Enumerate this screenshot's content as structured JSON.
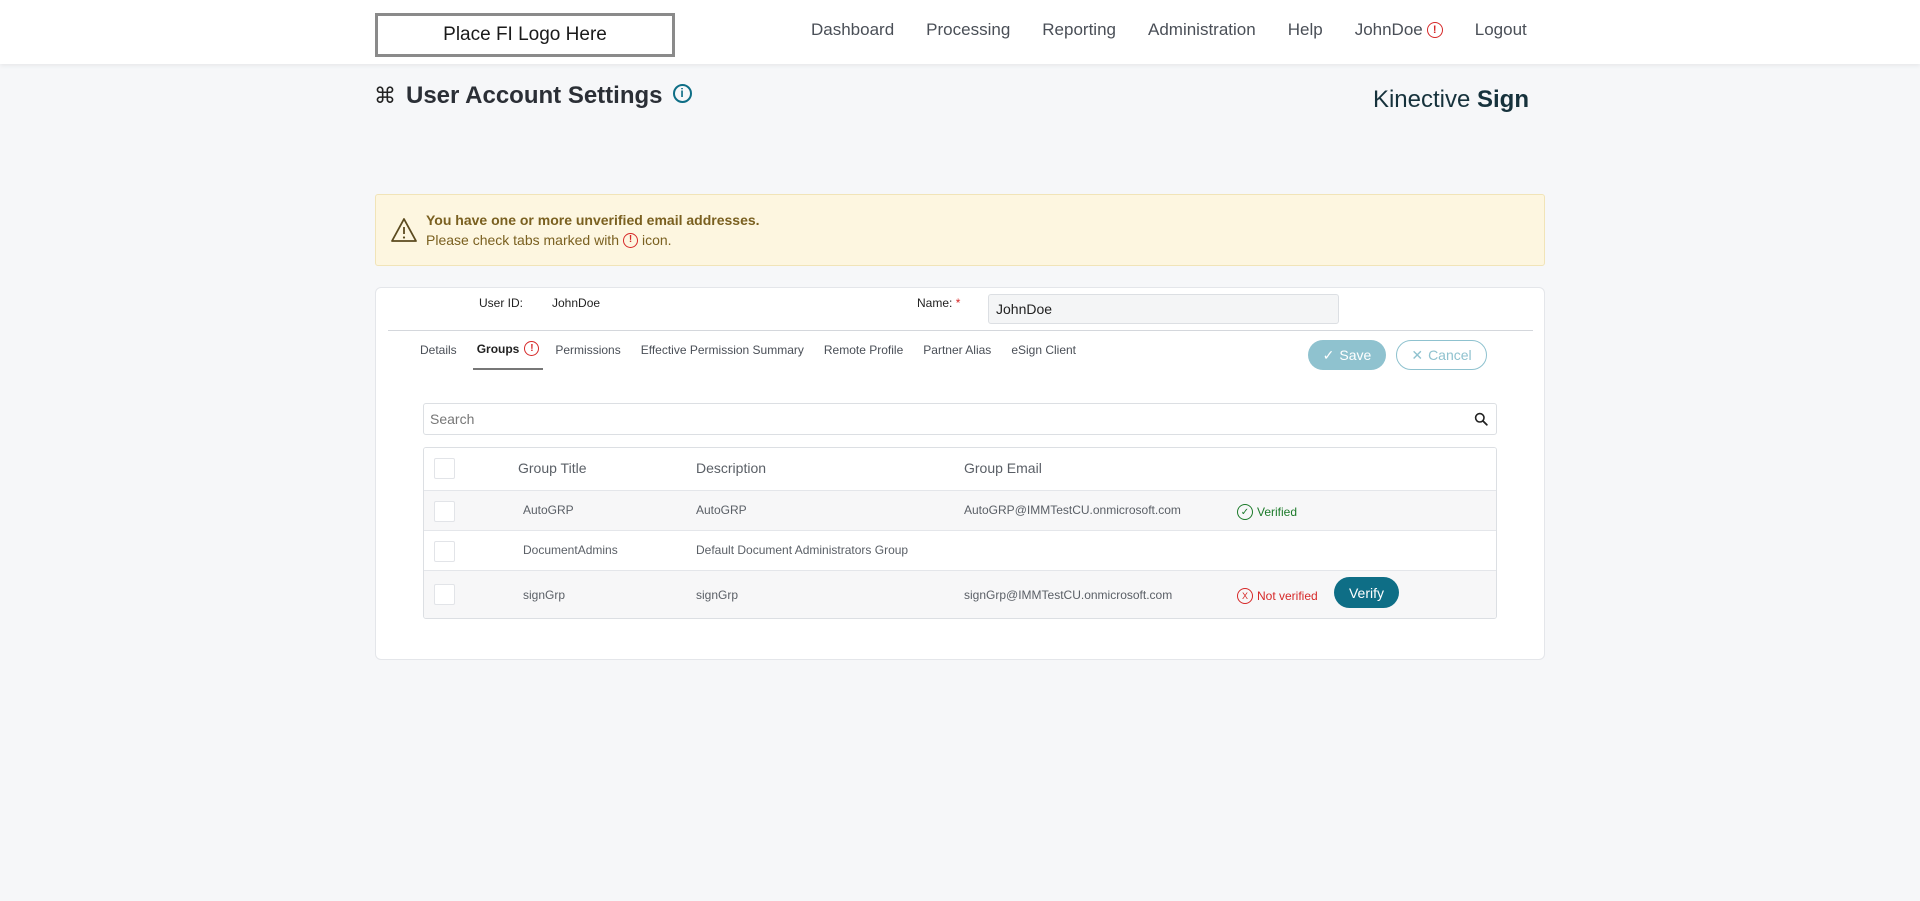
{
  "header": {
    "logo_text": "Place FI Logo Here",
    "nav": {
      "dashboard": "Dashboard",
      "processing": "Processing",
      "reporting": "Reporting",
      "administration": "Administration",
      "help": "Help",
      "user": "JohnDoe",
      "logout": "Logout"
    }
  },
  "page": {
    "title": "User Account Settings",
    "brand_light": "Kinective",
    "brand_bold": "Sign"
  },
  "alert": {
    "title": "You have one or more unverified email addresses.",
    "sub_before": "Please check tabs marked with",
    "sub_after": "icon."
  },
  "form": {
    "user_id_label": "User ID:",
    "user_id_value": "JohnDoe",
    "name_label": "Name:",
    "name_required": "*",
    "name_value": "JohnDoe"
  },
  "tabs": {
    "details": "Details",
    "groups": "Groups",
    "permissions": "Permissions",
    "effective": "Effective Permission Summary",
    "remote": "Remote Profile",
    "partner": "Partner Alias",
    "esign": "eSign Client"
  },
  "actions": {
    "save": "Save",
    "cancel": "Cancel"
  },
  "search": {
    "placeholder": "Search"
  },
  "grid": {
    "headers": {
      "title": "Group Title",
      "description": "Description",
      "email": "Group Email"
    },
    "rows": [
      {
        "title": "AutoGRP",
        "description": "AutoGRP",
        "email": "AutoGRP@IMMTestCU.onmicrosoft.com",
        "status": "Verified"
      },
      {
        "title": "DocumentAdmins",
        "description": "Default Document Administrators Group",
        "email": "",
        "status": ""
      },
      {
        "title": "signGrp",
        "description": "signGrp",
        "email": "signGrp@IMMTestCU.onmicrosoft.com",
        "status": "Not verified",
        "action": "Verify"
      }
    ]
  },
  "icons": {
    "error": "!",
    "info": "i",
    "check": "✓",
    "x": "X"
  }
}
